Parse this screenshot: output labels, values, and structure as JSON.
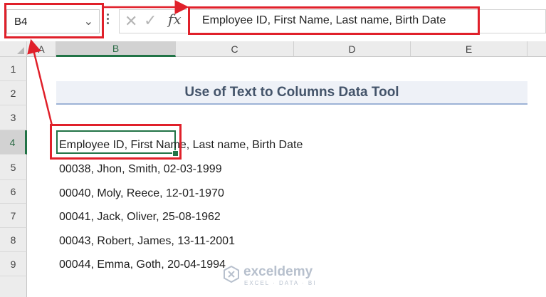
{
  "formula_bar": {
    "name_box": "B4",
    "formula": "Employee ID, First Name, Last name, Birth Date"
  },
  "columns": [
    "A",
    "B",
    "C",
    "D",
    "E"
  ],
  "rows": [
    "1",
    "2",
    "3",
    "4",
    "5",
    "6",
    "7",
    "8",
    "9"
  ],
  "sheet": {
    "title": "Use of Text to Columns Data Tool",
    "cells": [
      "Employee ID, First Name, Last name, Birth Date",
      "00038, Jhon, Smith, 02-03-1999",
      "00040, Moly, Reece, 12-01-1970",
      "00041, Jack, Oliver, 25-08-1962",
      "00043, Robert, James, 13-11-2001",
      "00044, Emma, Goth, 20-04-1994"
    ]
  },
  "watermark": {
    "name": "exceldemy",
    "tagline": "EXCEL · DATA · BI"
  },
  "colors": {
    "highlight_red": "#e0202a",
    "selection_green": "#217346",
    "title_text": "#44546a"
  }
}
